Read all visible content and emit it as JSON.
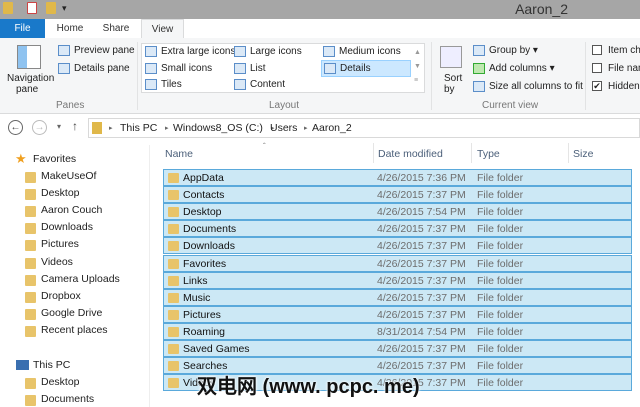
{
  "window": {
    "title": "Aaron_2"
  },
  "tabs": [
    "File",
    "Home",
    "Share",
    "View"
  ],
  "ribbon": {
    "panes": {
      "navigation_pane": "Navigation",
      "navigation_pane2": "pane",
      "preview_pane": "Preview pane",
      "details_pane": "Details pane",
      "group": "Panes"
    },
    "layout": {
      "items": [
        "Extra large icons",
        "Large icons",
        "Medium icons",
        "Small icons",
        "List",
        "Details",
        "Tiles",
        "Content"
      ],
      "group": "Layout"
    },
    "current_view": {
      "sort_by": "Sort",
      "sort_by2": "by",
      "group_by": "Group by",
      "add_columns": "Add columns",
      "size_all": "Size all columns to fit",
      "group": "Current view"
    },
    "show_hide": {
      "item_checkboxes": "Item che",
      "file_name_ext": "File nam",
      "hidden_items": "Hidden",
      "hidden_checked": true
    }
  },
  "address": {
    "crumbs": [
      "This PC",
      "Windows8_OS (C:)",
      "Users",
      "Aaron_2"
    ]
  },
  "nav": {
    "favorites": "Favorites",
    "fav_items": [
      "MakeUseOf",
      "Desktop",
      "Aaron Couch",
      "Downloads",
      "Pictures",
      "Videos",
      "Camera Uploads",
      "Dropbox",
      "Google Drive",
      "Recent places"
    ],
    "this_pc": "This PC",
    "pc_items": [
      "Desktop",
      "Documents"
    ]
  },
  "columns": {
    "name": "Name",
    "date": "Date modified",
    "type": "Type",
    "size": "Size"
  },
  "files": [
    {
      "name": "AppData",
      "date": "4/26/2015 7:36 PM",
      "type": "File folder"
    },
    {
      "name": "Contacts",
      "date": "4/26/2015 7:37 PM",
      "type": "File folder"
    },
    {
      "name": "Desktop",
      "date": "4/26/2015 7:54 PM",
      "type": "File folder"
    },
    {
      "name": "Documents",
      "date": "4/26/2015 7:37 PM",
      "type": "File folder"
    },
    {
      "name": "Downloads",
      "date": "4/26/2015 7:37 PM",
      "type": "File folder"
    },
    {
      "name": "Favorites",
      "date": "4/26/2015 7:37 PM",
      "type": "File folder"
    },
    {
      "name": "Links",
      "date": "4/26/2015 7:37 PM",
      "type": "File folder"
    },
    {
      "name": "Music",
      "date": "4/26/2015 7:37 PM",
      "type": "File folder"
    },
    {
      "name": "Pictures",
      "date": "4/26/2015 7:37 PM",
      "type": "File folder"
    },
    {
      "name": "Roaming",
      "date": "8/31/2014 7:54 PM",
      "type": "File folder"
    },
    {
      "name": "Saved Games",
      "date": "4/26/2015 7:37 PM",
      "type": "File folder"
    },
    {
      "name": "Searches",
      "date": "4/26/2015 7:37 PM",
      "type": "File folder"
    },
    {
      "name": "Videos",
      "date": "4/26/2015 7:37 PM",
      "type": "File folder"
    }
  ],
  "watermark": "双电网 (www. pcpc. me)"
}
